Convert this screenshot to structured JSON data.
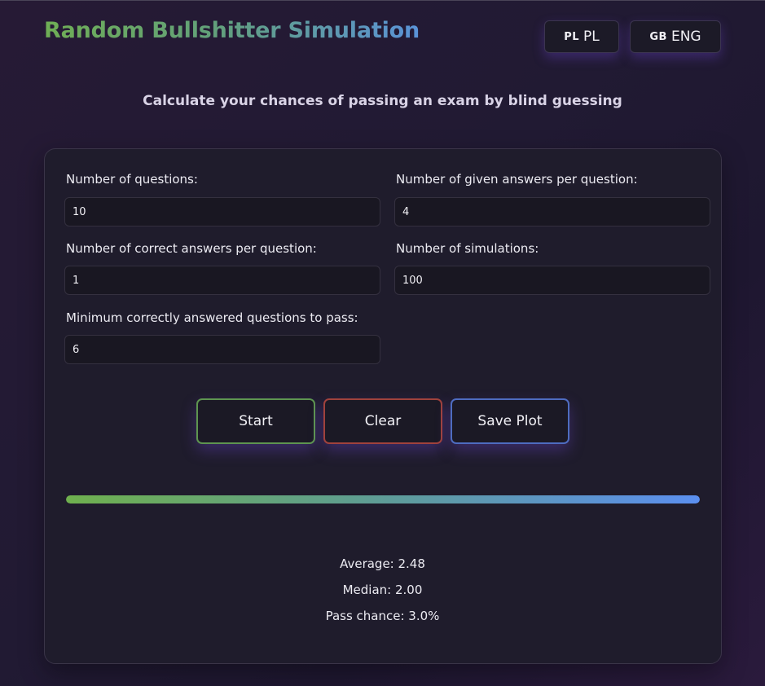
{
  "header": {
    "title": "Random Bullshitter Simulation",
    "subtitle": "Calculate your chances of passing an exam by blind guessing"
  },
  "languages": [
    {
      "flag": "PL",
      "label": "PL"
    },
    {
      "flag": "GB",
      "label": "ENG"
    }
  ],
  "form": {
    "questions": {
      "label": "Number of questions:",
      "value": "10"
    },
    "answers_per_question": {
      "label": "Number of given answers per question:",
      "value": "4"
    },
    "correct_per_question": {
      "label": "Number of correct answers per question:",
      "value": "1"
    },
    "simulations": {
      "label": "Number of simulations:",
      "value": "100"
    },
    "min_to_pass": {
      "label": "Minimum correctly answered questions to pass:",
      "value": "6"
    }
  },
  "buttons": {
    "start": "Start",
    "clear": "Clear",
    "save_plot": "Save Plot"
  },
  "progress": {
    "value": 1.0
  },
  "results": {
    "average": "Average: 2.48",
    "median": "Median: 2.00",
    "pass_chance": "Pass chance: 3.0%"
  },
  "colors": {
    "accent_green": "#6fb04e",
    "accent_blue": "#5b8ff0",
    "clear_red": "#a0423c",
    "background": "#231a33"
  }
}
